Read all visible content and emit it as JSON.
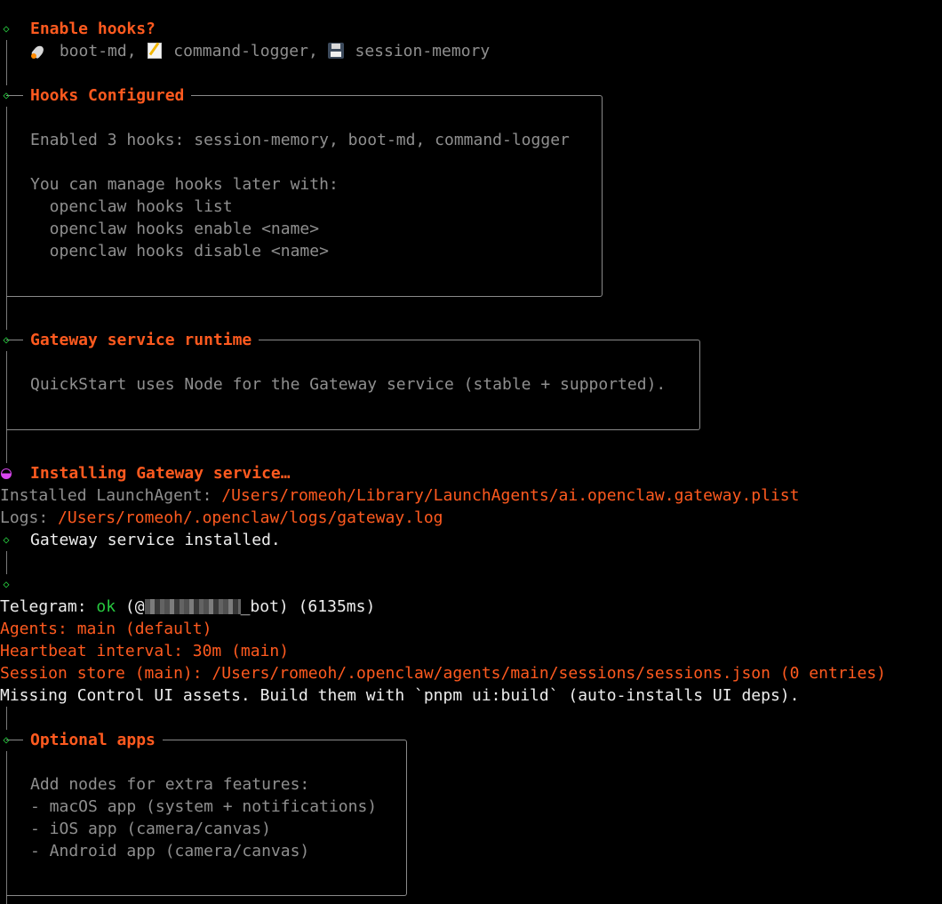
{
  "hooks_prompt": {
    "title": "Enable hooks?",
    "hooks": [
      {
        "icon": "rocket-icon",
        "label": "boot-md"
      },
      {
        "icon": "memo-icon",
        "label": "command-logger"
      },
      {
        "icon": "floppy-disk-icon",
        "label": "session-memory"
      }
    ],
    "separator": ", "
  },
  "hooks_configured": {
    "title": "Hooks Configured",
    "enabled_line": "Enabled 3 hooks: session-memory, boot-md, command-logger",
    "manage_line": "You can manage hooks later with:",
    "commands": [
      "  openclaw hooks list",
      "  openclaw hooks enable <name>",
      "  openclaw hooks disable <name>"
    ]
  },
  "gateway_runtime": {
    "title": "Gateway service runtime",
    "body": "QuickStart uses Node for the Gateway service (stable + supported)."
  },
  "install": {
    "title": "Installing Gateway service…",
    "launch_agent_label": "Installed LaunchAgent: ",
    "launch_agent_path": "/Users/romeoh/Library/LaunchAgents/ai.openclaw.gateway.plist",
    "logs_label": "Logs: ",
    "logs_path": "/Users/romeoh/.openclaw/logs/gateway.log",
    "installed_message": "Gateway service installed."
  },
  "status": {
    "telegram_label": "Telegram: ",
    "telegram_status": "ok",
    "telegram_handle_prefix": " (@",
    "telegram_handle_suffix": "_bot) (6135ms)",
    "agents": "Agents: main (default)",
    "heartbeat": "Heartbeat interval: 30m (main)",
    "session_store": "Session store (main): /Users/romeoh/.openclaw/agents/main/sessions/sessions.json (0 entries)",
    "missing_assets": "Missing Control UI assets. Build them with `pnpm ui:build` (auto-installs UI deps)."
  },
  "optional_apps": {
    "title": "Optional apps",
    "intro": "Add nodes for extra features:",
    "items": [
      "- macOS app (system + notifications)",
      "- iOS app (camera/canvas)",
      "- Android app (camera/canvas)"
    ]
  },
  "colors": {
    "background": "#000000",
    "accent_orange": "#ff5a1f",
    "success_green": "#27c93f",
    "spinner_magenta": "#d946ef",
    "dim_text": "#8f8f8f",
    "box_border": "#8a8a8a"
  }
}
